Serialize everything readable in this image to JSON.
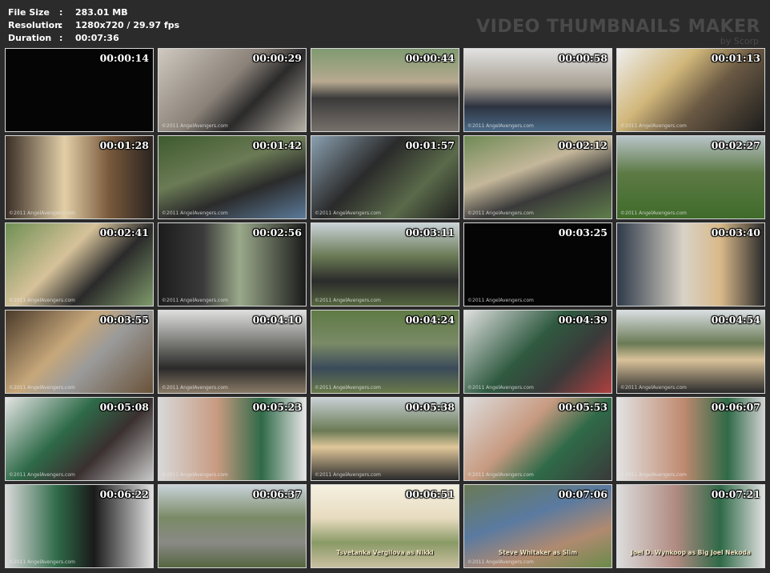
{
  "info": {
    "file_size_label": "File Size",
    "file_size_value": "283.01 MB",
    "resolution_label": "Resolution",
    "resolution_value": "1280x720 / 29.97 fps",
    "duration_label": "Duration",
    "duration_value": "00:07:36",
    "separator": ":"
  },
  "watermark": {
    "title": "VIDEO THUMBNAILS MAKER",
    "byline": "by Scorp"
  },
  "copyright": "©2011 AngelAvengers.com",
  "thumbnails": [
    {
      "time": "00:00:14",
      "bg": "#050505",
      "credit": false,
      "caption": ""
    },
    {
      "time": "00:00:29",
      "bg": "linear-gradient(135deg,#cfc9c0 0%,#8a8178 45%,#2a2a2a 65%,#b7b0a6 100%)",
      "credit": true,
      "caption": ""
    },
    {
      "time": "00:00:44",
      "bg": "linear-gradient(180deg,#7f9a70 0%,#b7a990 40%,#3a3a3a 60%,#77706a 100%)",
      "credit": false,
      "caption": ""
    },
    {
      "time": "00:00:58",
      "bg": "linear-gradient(180deg,#e2e2e2 0%,#a79f92 45%,#2d3340 70%,#4a6b88 100%)",
      "credit": true,
      "caption": ""
    },
    {
      "time": "00:01:13",
      "bg": "linear-gradient(135deg,#eeeeee 0%,#d1b77a 35%,#6b5a44 60%,#1c1c1c 100%)",
      "credit": true,
      "caption": ""
    },
    {
      "time": "00:01:28",
      "bg": "linear-gradient(90deg,#3a2e26 0%,#e2cfa8 40%,#7a5a3c 70%,#2a2420 100%)",
      "credit": true,
      "caption": ""
    },
    {
      "time": "00:01:42",
      "bg": "linear-gradient(160deg,#3e5a2e 0%,#6b7b55 40%,#2b2b2b 65%,#5b7b9a 100%)",
      "credit": true,
      "caption": ""
    },
    {
      "time": "00:01:57",
      "bg": "linear-gradient(135deg,#8aa0b0 0%,#2a2a2a 40%,#5a6a4a 70%,#1e1e1e 100%)",
      "credit": true,
      "caption": ""
    },
    {
      "time": "00:02:12",
      "bg": "linear-gradient(160deg,#6f8a55 0%,#c4b79a 40%,#3a3a3a 65%,#5f7e4a 100%)",
      "credit": true,
      "caption": ""
    },
    {
      "time": "00:02:27",
      "bg": "linear-gradient(180deg,#b8c4c8 0%,#5d7a45 45%,#3f6b2a 100%)",
      "credit": true,
      "caption": ""
    },
    {
      "time": "00:02:41",
      "bg": "linear-gradient(135deg,#6f8f55 0%,#d6c29a 40%,#2a2a2a 65%,#7e9a6a 100%)",
      "credit": true,
      "caption": ""
    },
    {
      "time": "00:02:56",
      "bg": "linear-gradient(90deg,#1c1c1c 0%,#3a3a3a 30%,#9aa98a 55%,#1a1a1a 100%)",
      "credit": true,
      "caption": ""
    },
    {
      "time": "00:03:11",
      "bg": "linear-gradient(180deg,#c9d2d6 0%,#6a7a55 40%,#2b2b2b 70%,#55663f 100%)",
      "credit": true,
      "caption": ""
    },
    {
      "time": "00:03:25",
      "bg": "#050505",
      "credit": true,
      "caption": ""
    },
    {
      "time": "00:03:40",
      "bg": "linear-gradient(90deg,#2f3a4a 0%,#d8d2c6 45%,#d9b98a 70%,#2a2a2a 100%)",
      "credit": false,
      "caption": ""
    },
    {
      "time": "00:03:55",
      "bg": "linear-gradient(135deg,#4a3a2a 0%,#c6a77a 40%,#9a9a9a 60%,#6a5238 100%)",
      "credit": true,
      "caption": ""
    },
    {
      "time": "00:04:10",
      "bg": "linear-gradient(180deg,#dedede 0%,#6a6a66 45%,#2a2a2a 70%,#8a7a66 100%)",
      "credit": true,
      "caption": ""
    },
    {
      "time": "00:04:24",
      "bg": "linear-gradient(180deg,#5f7a45 0%,#7a8a66 40%,#3a4a5a 70%,#6a7a4a 100%)",
      "credit": true,
      "caption": ""
    },
    {
      "time": "00:04:39",
      "bg": "linear-gradient(135deg,#e0e0e0 0%,#2f5a40 45%,#3a3a3a 70%,#b04040 100%)",
      "credit": true,
      "caption": ""
    },
    {
      "time": "00:04:54",
      "bg": "linear-gradient(180deg,#d8dde0 0%,#6a7a55 40%,#d9c29a 60%,#2a2a2a 100%)",
      "credit": true,
      "caption": ""
    },
    {
      "time": "00:05:08",
      "bg": "linear-gradient(135deg,#e4e4e4 0%,#2e6a48 40%,#3a3030 65%,#c8c8c8 100%)",
      "credit": true,
      "caption": ""
    },
    {
      "time": "00:05:23",
      "bg": "linear-gradient(90deg,#d8d8d8 0%,#c79a80 40%,#2f6a48 70%,#e6e6e6 100%)",
      "credit": true,
      "caption": ""
    },
    {
      "time": "00:05:38",
      "bg": "linear-gradient(180deg,#c8d0d4 0%,#6a7a55 40%,#e0c79a 60%,#2a2a2a 100%)",
      "credit": true,
      "caption": ""
    },
    {
      "time": "00:05:53",
      "bg": "linear-gradient(135deg,#dcdcdc 0%,#c79a80 40%,#2f6a48 65%,#3a3a3a 100%)",
      "credit": true,
      "caption": ""
    },
    {
      "time": "00:06:07",
      "bg": "linear-gradient(90deg,#e2e2e2 0%,#c08a70 45%,#2f6a48 75%,#d0d0d0 100%)",
      "credit": true,
      "caption": ""
    },
    {
      "time": "00:06:22",
      "bg": "linear-gradient(90deg,#d8d8d8 0%,#2f6a48 35%,#1a1a1a 60%,#e0e0e0 100%)",
      "credit": true,
      "caption": ""
    },
    {
      "time": "00:06:37",
      "bg": "linear-gradient(180deg,#c8d2d8 0%,#7a8a66 40%,#8a8a86 70%,#55663f 100%)",
      "credit": false,
      "caption": ""
    },
    {
      "time": "00:06:51",
      "bg": "linear-gradient(180deg,#f4f0e0 0%,#e8dcc0 40%,#8a9a66 70%,#c9c0a0 100%)",
      "credit": false,
      "caption": "Tsvetanka Vergilova as Nikki"
    },
    {
      "time": "00:07:06",
      "bg": "linear-gradient(160deg,#6a7a55 0%,#5a7aa0 40%,#b08a70 70%,#6a8a4a 100%)",
      "credit": true,
      "caption": "Steve Whitaker as Slim"
    },
    {
      "time": "00:07:21",
      "bg": "linear-gradient(90deg,#dcdcdc 0%,#b08a80 40%,#2f6a48 70%,#e0e0e0 100%)",
      "credit": false,
      "caption": "Joel D. Wynkoop as Big Joel Nekoda"
    }
  ]
}
